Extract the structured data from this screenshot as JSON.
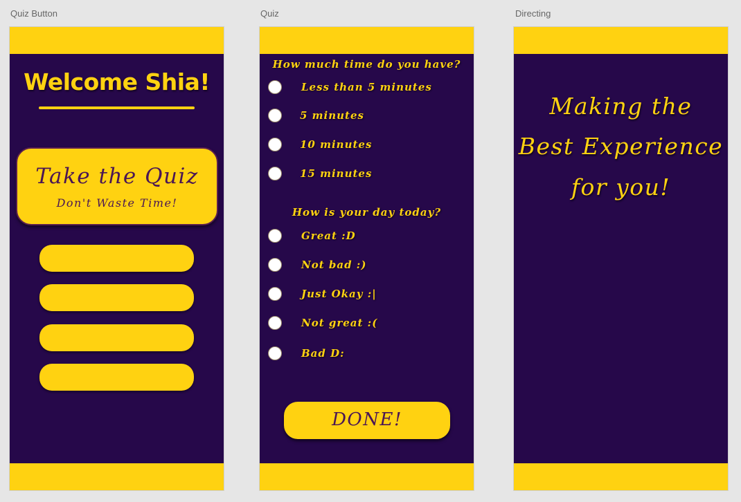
{
  "artboards": {
    "quiz_button": {
      "label": "Quiz Button",
      "welcome_title": "Welcome Shia!",
      "card_title": "Take the Quiz",
      "card_subtitle": "Don't Waste Time!"
    },
    "quiz": {
      "label": "Quiz",
      "question_time": "How much time do you have?",
      "time_options": [
        "Less than 5 minutes",
        "5 minutes",
        "10 minutes",
        "15 minutes"
      ],
      "question_day": "How is your day today?",
      "day_options": [
        "Great :D",
        "Not bad :)",
        "Just Okay :|",
        "Not great :(",
        "Bad D:"
      ],
      "done_label": "DONE!"
    },
    "directing": {
      "label": "Directing",
      "lines": [
        "Making the",
        "Best Experience",
        "for you!"
      ]
    }
  },
  "colors": {
    "canvas": "#e6e6e6",
    "screen_bg": "#26084a",
    "accent_yellow": "#ffd211",
    "text_purple": "#4a1654"
  }
}
